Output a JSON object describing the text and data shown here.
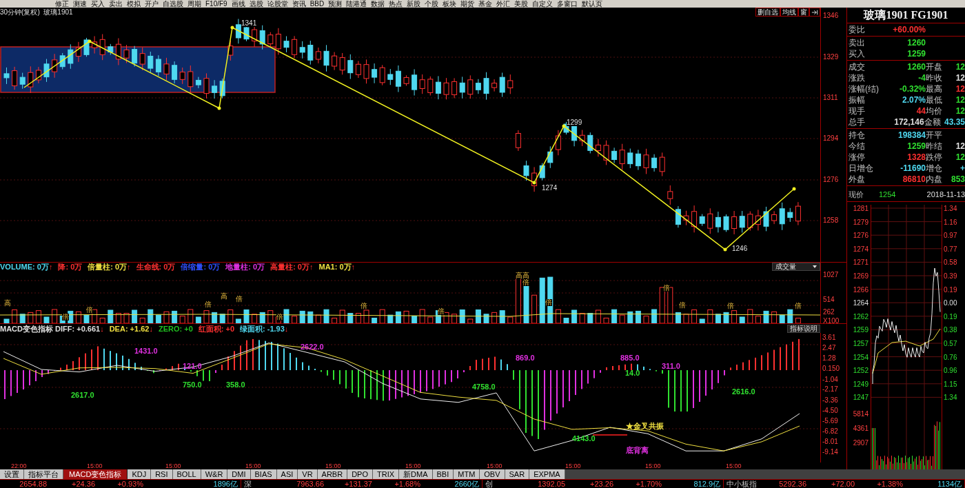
{
  "toolbar": [
    "修正",
    "测速",
    "买入",
    "卖出",
    "模拟",
    "开户",
    "自选股",
    "周期",
    "F10/F9",
    "画线",
    "选股",
    "论股堂",
    "资讯",
    "BBD",
    "预测",
    "陆港通",
    "数据",
    "热点",
    "新股",
    "个股",
    "板块",
    "期货",
    "基金",
    "外汇",
    "美股",
    "自定义",
    "多窗口",
    "默认页"
  ],
  "chart_header": {
    "title": "30分钟(复权)  玻璃1901",
    "buttons": [
      "删自选",
      "均线",
      "窗"
    ]
  },
  "price_axis": [
    "1346",
    "1329",
    "1311",
    "1294",
    "1276",
    "1258"
  ],
  "price_annotations": [
    "1341",
    "1299",
    "1274",
    "1246"
  ],
  "volume_header": {
    "items": [
      {
        "label": "VOLUME: 0万",
        "arrow": "↑",
        "color": "#4fd8f0"
      },
      {
        "label": "降: 0万",
        "color": "#ff3030"
      },
      {
        "label": "倍量柱: 0万",
        "arrow": "↑",
        "color": "#f0e040"
      },
      {
        "label": "生命线: 0万",
        "color": "#ff3030"
      },
      {
        "label": "倍缩量: 0万",
        "color": "#3050ff"
      },
      {
        "label": "地量柱: 0万",
        "color": "#e030e0"
      },
      {
        "label": "高量柱: 0万",
        "arrow": "↑",
        "color": "#ff3030"
      },
      {
        "label": "MA1: 0万",
        "arrow": "↑",
        "color": "#f0e040"
      }
    ],
    "dropdown": "成交量"
  },
  "volume_axis": [
    "1027",
    "514",
    "262",
    "X100"
  ],
  "volume_markers": [
    "高",
    "倍",
    "倍",
    "倍",
    "高",
    "倍",
    "倍",
    "倍",
    "倍",
    "高高",
    "倍",
    "倍",
    "倍",
    "倍",
    "倍",
    "倍"
  ],
  "macd_header": {
    "items": [
      {
        "label": "MACD变色指标 DIFF: +0.661",
        "arrow": "↓",
        "color": "#e0e0e0"
      },
      {
        "label": "DEA: +1.62",
        "arrow": "↓",
        "color": "#f0e040"
      },
      {
        "label": "ZERO: +0",
        "color": "#20c020"
      },
      {
        "label": "红面积: +0",
        "color": "#ff3030"
      },
      {
        "label": "绿面积: -1.93",
        "arrow": "↓",
        "color": "#4fd8f0"
      }
    ],
    "button": "指标说明"
  },
  "macd": {
    "chart_data": {
      "type": "line",
      "ylim": [
        -10.29,
        4.15
      ],
      "yticks": [
        {
          "value": 3.61,
          "label": "3.61"
        },
        {
          "value": 2.47,
          "label": "2.47"
        },
        {
          "value": 1.28,
          "label": "1.28"
        },
        {
          "value": 0.15,
          "label": "0.150"
        },
        {
          "value": -1.04,
          "label": "-1.04"
        },
        {
          "value": -2.17,
          "label": "-2.17"
        },
        {
          "value": -3.36,
          "label": "-3.36"
        },
        {
          "value": -4.5,
          "label": "-4.50"
        },
        {
          "value": -5.69,
          "label": "-5.69"
        },
        {
          "value": -6.82,
          "label": "-6.82"
        },
        {
          "value": -8.01,
          "label": "-8.01"
        },
        {
          "value": -9.14,
          "label": "-9.14"
        }
      ],
      "series": [
        {
          "color": "#f0f0f0",
          "values": [
            2.07,
            0.08,
            -0.2,
            0.54,
            -0.13,
            0.35,
            1.5,
            3.03,
            1.98,
            0.92,
            -1.48,
            -3.21,
            -3.59,
            -2.53,
            -9.0,
            -7.83,
            -6.37,
            -7.09,
            -9.0,
            -9.0,
            -7.66,
            -4.84
          ]
        },
        {
          "color": "#f0e040",
          "values": [
            1.31,
            -0.46,
            0.25,
            0.31,
            0.18,
            -0.35,
            1.27,
            2.93,
            2.49,
            1.17,
            -0.65,
            -2.48,
            -3.0,
            -3.37,
            -5.45,
            -6.6,
            -6.41,
            -6.77,
            -8.24,
            -9.0,
            -7.98,
            -6.22
          ]
        }
      ]
    }
  },
  "macd_labels": [
    {
      "text": "1431.0",
      "color": "#e030e0"
    },
    {
      "text": "121.0",
      "color": "#e030e0"
    },
    {
      "text": "750.0",
      "color": "#30e030"
    },
    {
      "text": "358.0",
      "color": "#30e030"
    },
    {
      "text": "2617.0",
      "color": "#30e030"
    },
    {
      "text": "2622.0",
      "color": "#e030e0"
    },
    {
      "text": "869.0",
      "color": "#e030e0"
    },
    {
      "text": "4758.0",
      "color": "#30e030"
    },
    {
      "text": "885.0",
      "color": "#e030e0"
    },
    {
      "text": "14.0",
      "color": "#30e030"
    },
    {
      "text": "311.0",
      "color": "#e030e0"
    },
    {
      "text": "2616.0",
      "color": "#30e030"
    },
    {
      "text": "4143.0",
      "color": "#30e030"
    },
    {
      "text": "★金叉共振",
      "color": "#f0e040"
    },
    {
      "text": "底背离",
      "color": "#e030e0"
    }
  ],
  "time_axis": [
    "22:00",
    "15:00",
    "15:00",
    "15:00",
    "15:00",
    "15:00",
    "15:00",
    "15:00",
    "15:00",
    "15:00"
  ],
  "tabs": [
    {
      "label": "设置",
      "selected": false
    },
    {
      "label": "指标平台",
      "selected": false
    },
    {
      "label": "MACD变色指标",
      "selected": true
    },
    {
      "label": "KDJ",
      "selected": false
    },
    {
      "label": "RSI",
      "selected": false
    },
    {
      "label": "BOLL",
      "selected": false
    },
    {
      "label": "W&R",
      "selected": false
    },
    {
      "label": "DMI",
      "selected": false
    },
    {
      "label": "BIAS",
      "selected": false
    },
    {
      "label": "ASI",
      "selected": false
    },
    {
      "label": "VR",
      "selected": false
    },
    {
      "label": "ARBR",
      "selected": false
    },
    {
      "label": "DPO",
      "selected": false
    },
    {
      "label": "TRIX",
      "selected": false
    },
    {
      "label": "新DMA",
      "selected": false
    },
    {
      "label": "BBI",
      "selected": false
    },
    {
      "label": "MTM",
      "selected": false
    },
    {
      "label": "OBV",
      "selected": false
    },
    {
      "label": "SAR",
      "selected": false
    },
    {
      "label": "EXPMA",
      "selected": false
    }
  ],
  "quote": {
    "title": "玻璃1901 FG1901",
    "groups": [
      [
        {
          "cells": [
            {
              "label": "委比",
              "value": "+60.00%",
              "color": "#ff3030"
            }
          ]
        }
      ],
      [
        {
          "cells": [
            {
              "label": "卖出",
              "value": "1260",
              "color": "#30e030"
            }
          ]
        },
        {
          "cells": [
            {
              "label": "买入",
              "value": "1259",
              "color": "#30e030"
            }
          ]
        }
      ],
      [
        {
          "cells": [
            {
              "label": "成交",
              "value": "1260",
              "color": "#30e030"
            },
            {
              "label": "开盘",
              "value": "12",
              "color": "#30e030"
            }
          ]
        },
        {
          "cells": [
            {
              "label": "涨跌",
              "value": "-4",
              "color": "#30e030"
            },
            {
              "label": "昨收",
              "value": "12",
              "color": "#e0e0e0"
            }
          ]
        },
        {
          "cells": [
            {
              "label": "涨幅(结)",
              "value": "-0.32%",
              "color": "#30e030"
            },
            {
              "label": "最高",
              "value": "12",
              "color": "#ff3030"
            }
          ]
        },
        {
          "cells": [
            {
              "label": "振幅",
              "value": "2.07%",
              "color": "#4fd8f0"
            },
            {
              "label": "最低",
              "value": "12",
              "color": "#30e030"
            }
          ]
        },
        {
          "cells": [
            {
              "label": "现手",
              "value": "44",
              "color": "#ff3030"
            },
            {
              "label": "均价",
              "value": "12",
              "color": "#30e030"
            }
          ]
        },
        {
          "cells": [
            {
              "label": "总手",
              "value": "172,146",
              "color": "#e0e0e0"
            },
            {
              "label": "金额",
              "value": "43.35",
              "color": "#4fd8f0"
            }
          ]
        }
      ],
      [
        {
          "cells": [
            {
              "label": "持仓",
              "value": "198384",
              "color": "#4fd8f0"
            },
            {
              "label": "开平"
            }
          ]
        },
        {
          "cells": [
            {
              "label": "今结",
              "value": "1259",
              "color": "#30e030"
            },
            {
              "label": "昨结",
              "value": "12",
              "color": "#e0e0e0"
            }
          ]
        },
        {
          "cells": [
            {
              "label": "涨停",
              "value": "1328",
              "color": "#ff3030"
            },
            {
              "label": "跌停",
              "value": "12",
              "color": "#30e030"
            }
          ]
        },
        {
          "cells": [
            {
              "label": "日增仓",
              "value": "-11690",
              "color": "#4fd8f0"
            },
            {
              "label": "增仓",
              "value": "+",
              "color": "#4fd8f0"
            }
          ]
        },
        {
          "cells": [
            {
              "label": "外盘",
              "value": "86810",
              "color": "#ff3030"
            },
            {
              "label": "内盘",
              "value": "853",
              "color": "#30e030"
            }
          ]
        }
      ]
    ],
    "now": {
      "label": "现价",
      "value": "1254",
      "date": "2018-11-13"
    }
  },
  "intraday": {
    "price_axis": [
      "1281",
      "1279",
      "1276",
      "1274",
      "1271",
      "1269",
      "1266",
      "1264",
      "1262",
      "1259",
      "1257",
      "1254",
      "1252",
      "1249",
      "1247"
    ],
    "pct_axis": [
      "1.34",
      "1.16",
      "0.97",
      "0.77",
      "0.58",
      "0.39",
      "0.19",
      "0.00",
      "0.19",
      "0.38",
      "0.57",
      "0.76",
      "0.96",
      "1.15",
      "1.34"
    ],
    "volume_axis": [
      "5814",
      "4361",
      "2907"
    ]
  },
  "status_bar": [
    {
      "value": "2654.88",
      "change": "+24.36",
      "pct": "+0.93%",
      "amount": "1896亿"
    },
    {
      "name": "深",
      "value": "7963.66",
      "change": "+131.37",
      "pct": "+1.68%",
      "amount": "2660亿"
    },
    {
      "name": "创",
      "value": "1392.05",
      "change": "+23.26",
      "pct": "+1.70%",
      "amount": "812.9亿"
    },
    {
      "name": "中小板指",
      "value": "5292.36",
      "change": "+72.00",
      "pct": "+1.38%",
      "amount": "1134亿"
    }
  ]
}
